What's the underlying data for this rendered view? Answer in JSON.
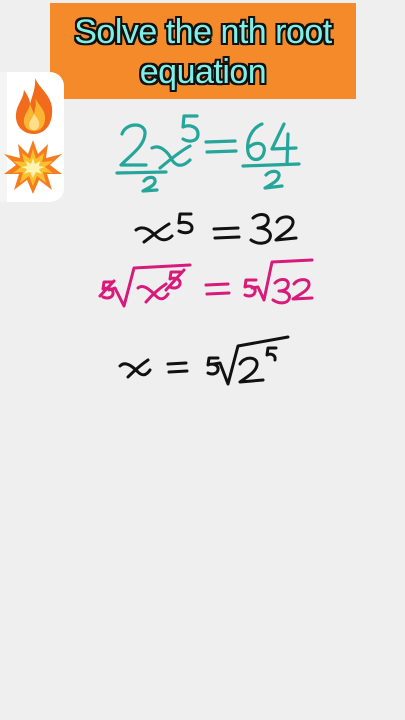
{
  "title": {
    "line1": "Solve the nth root",
    "line2": "equation"
  },
  "reactions": {
    "fire_icon": "fire-icon",
    "explosion_icon": "explosion-icon"
  },
  "colors": {
    "banner": "#f58a2a",
    "title_text": "#7ff0e8",
    "teal_ink": "#26a69a",
    "magenta_ink": "#d81b7a",
    "black_ink": "#111111"
  },
  "equations": [
    "2x^5/2 = 64/2",
    "x^5 = 32",
    "5√(x^5) = 5√32",
    "x = 5√(2^5)"
  ]
}
